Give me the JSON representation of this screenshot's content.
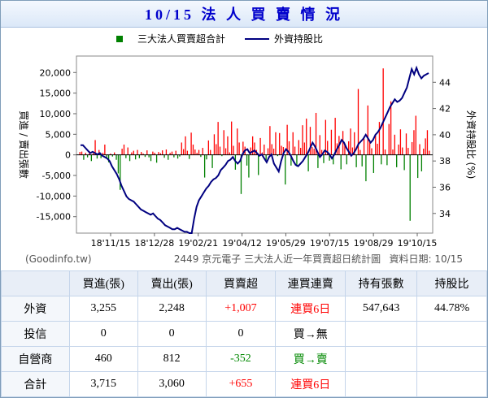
{
  "title": "10/15 法 人 買 賣 情 況",
  "chart_data": {
    "type": "bar",
    "legend": {
      "items": [
        {
          "label": "三大法人買賣超合計",
          "color": "#008000",
          "shape": "square"
        },
        {
          "label": "外資持股比",
          "color": "#000080",
          "shape": "line"
        }
      ],
      "placement": "top"
    },
    "ylabel_left": "買進 / 賣出張數",
    "ylabel_right": "外資持股比 (%)",
    "ylim_left": [
      -19000,
      24000
    ],
    "ylim_right": [
      32.5,
      46
    ],
    "yticks_left": [
      "20,000",
      "15,000",
      "10,000",
      "5,000",
      "0",
      "-5,000",
      "-10,000",
      "-15,000"
    ],
    "yticks_right": [
      "44",
      "42",
      "40",
      "38",
      "36",
      "34"
    ],
    "xticks": [
      "18'11/15",
      "18'12/28",
      "19'02/21",
      "19'04/12",
      "19'05/29",
      "19'07/15",
      "19'08/29",
      "19'10/15"
    ],
    "note_left": "(Goodinfo.tw)",
    "note_center": "2449 京元電子 三大法人近一年買賣超日統計圖",
    "note_right": "資料日期: 10/15",
    "series": [
      {
        "name": "三大法人買賣超合計",
        "color_pos": "#ff0000",
        "color_neg": "#008000",
        "values": [
          700,
          800,
          -1200,
          500,
          -600,
          900,
          -1500,
          400,
          3600,
          -900,
          1200,
          -800,
          500,
          2500,
          -600,
          -1800,
          300,
          -400,
          600,
          -1200,
          -4500,
          -8500,
          1500,
          2500,
          -800,
          1800,
          -1500,
          600,
          1000,
          -1100,
          1200,
          -800,
          700,
          300,
          -500,
          1100,
          -600,
          -1500,
          800,
          500,
          -1900,
          700,
          400,
          1100,
          -700,
          1300,
          -1200,
          500,
          800,
          -600,
          1000,
          -900,
          -400,
          3000,
          1400,
          4500,
          1000,
          -1000,
          5400,
          2500,
          1300,
          500,
          1200,
          -500,
          1700,
          -5500,
          -1100,
          3500,
          1200,
          -3200,
          5000,
          2600,
          8000,
          2000,
          -300,
          6000,
          1600,
          4500,
          600,
          8100,
          2200,
          -3600,
          6400,
          3000,
          -9500,
          3200,
          2000,
          -2600,
          -5500,
          1800,
          4500,
          3000,
          1200,
          -4900,
          4100,
          600,
          2500,
          -1300,
          1600,
          7000,
          2600,
          1500,
          5500,
          -300,
          5300,
          2200,
          1900,
          -7200,
          7300,
          3300,
          -2600,
          5500,
          2000,
          -2800,
          3600,
          1700,
          7200,
          3000,
          8800,
          -4000,
          6800,
          1900,
          1500,
          10200,
          -3200,
          4800,
          1200,
          -2000,
          8500,
          3400,
          -1400,
          6100,
          -2300,
          9000,
          2800,
          4600,
          -3500,
          5800,
          2600,
          -2300,
          3300,
          6400,
          1800,
          5500,
          -3000,
          16000,
          1200,
          -2800,
          4000,
          -6400,
          12000,
          3100,
          1600,
          -4400,
          5100,
          2700,
          8000,
          -2300,
          21000,
          1300,
          -2500,
          7500,
          13000,
          1300,
          4900,
          -3000,
          2500,
          6200,
          1800,
          -3700,
          5200,
          1700,
          -16000,
          3100,
          6000,
          9500,
          -5600,
          2600,
          -4000,
          1500,
          4000,
          6000,
          1007
        ]
      },
      {
        "name": "外資持股比",
        "color": "#000080",
        "values": [
          39.2,
          39.2,
          39.0,
          38.8,
          38.6,
          38.7,
          38.6,
          38.5,
          38.6,
          38.4,
          38.3,
          38.2,
          38.0,
          37.6,
          37.3,
          37.0,
          36.6,
          36.1,
          35.7,
          35.3,
          35.1,
          35.0,
          34.9,
          34.7,
          34.5,
          34.3,
          34.2,
          34.1,
          34.0,
          33.9,
          34.0,
          33.8,
          33.6,
          33.5,
          33.3,
          33.1,
          33.0,
          32.9,
          32.8,
          32.8,
          32.9,
          32.8,
          32.7,
          32.6,
          32.6,
          32.5,
          32.5,
          33.6,
          34.5,
          35.0,
          35.3,
          35.6,
          35.9,
          36.1,
          36.4,
          36.6,
          36.7,
          36.9,
          37.3,
          37.5,
          37.7,
          38.0,
          38.1,
          38.3,
          38.0,
          37.8,
          38.0,
          38.5,
          38.8,
          38.9,
          38.6,
          38.7,
          38.8,
          38.6,
          38.4,
          38.5,
          38.2,
          37.9,
          38.3,
          38.5,
          37.8,
          37.5,
          37.2,
          38.0,
          38.6,
          38.9,
          38.7,
          38.4,
          38.0,
          37.7,
          37.6,
          37.8,
          38.0,
          38.3,
          38.6,
          39.0,
          39.4,
          39.1,
          38.7,
          38.3,
          38.5,
          38.8,
          38.7,
          38.5,
          38.2,
          38.5,
          38.9,
          39.2,
          39.6,
          39.4,
          39.0,
          38.7,
          38.4,
          38.6,
          38.9,
          39.3,
          39.5,
          39.7,
          40.0,
          39.7,
          39.4,
          39.6,
          40.0,
          40.2,
          40.5,
          40.9,
          41.3,
          41.7,
          42.1,
          42.4,
          42.7,
          42.5,
          42.6,
          42.8,
          43.2,
          43.6,
          44.3,
          45.0,
          44.6,
          45.1,
          44.6,
          44.3,
          44.5,
          44.6,
          44.7
        ]
      }
    ]
  },
  "table": {
    "headers": [
      "",
      "買進(張)",
      "賣出(張)",
      "買賣超",
      "連買連賣",
      "持有張數",
      "持股比"
    ],
    "rows": [
      {
        "label": "外資",
        "buy": "3,255",
        "sell": "2,248",
        "net": "+1,007",
        "streak": "連買6日",
        "holding": "547,643",
        "ratio": "44.78%",
        "net_color": "red",
        "streak_color": "red"
      },
      {
        "label": "投信",
        "buy": "0",
        "sell": "0",
        "net": "0",
        "streak": "買→無",
        "holding": "",
        "ratio": "",
        "net_color": "",
        "streak_color": ""
      },
      {
        "label": "自營商",
        "buy": "460",
        "sell": "812",
        "net": "-352",
        "streak": "買→賣",
        "holding": "",
        "ratio": "",
        "net_color": "green",
        "streak_color": "green"
      },
      {
        "label": "合計",
        "buy": "3,715",
        "sell": "3,060",
        "net": "+655",
        "streak": "連買6日",
        "holding": "",
        "ratio": "",
        "net_color": "red",
        "streak_color": "red"
      }
    ]
  }
}
